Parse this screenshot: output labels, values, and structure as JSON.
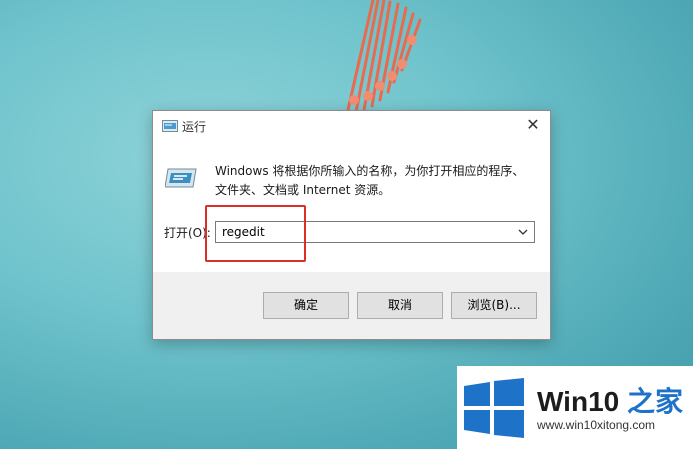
{
  "dialog": {
    "title": "运行",
    "description": "Windows 将根据你所输入的名称，为你打开相应的程序、文件夹、文档或 Internet 资源。",
    "open_label": "打开(O):",
    "open_value": "regedit",
    "buttons": {
      "ok": "确定",
      "cancel": "取消",
      "browse": "浏览(B)..."
    }
  },
  "icons": {
    "title": "run-icon",
    "app": "run-app-icon",
    "close": "close-icon",
    "dropdown": "chevron-down-icon"
  },
  "watermark": {
    "brand_prefix": "Win10",
    "brand_suffix": "之家",
    "url": "www.win10xitong.com"
  },
  "colors": {
    "highlight": "#d9302a",
    "accent": "#1e73c8"
  }
}
